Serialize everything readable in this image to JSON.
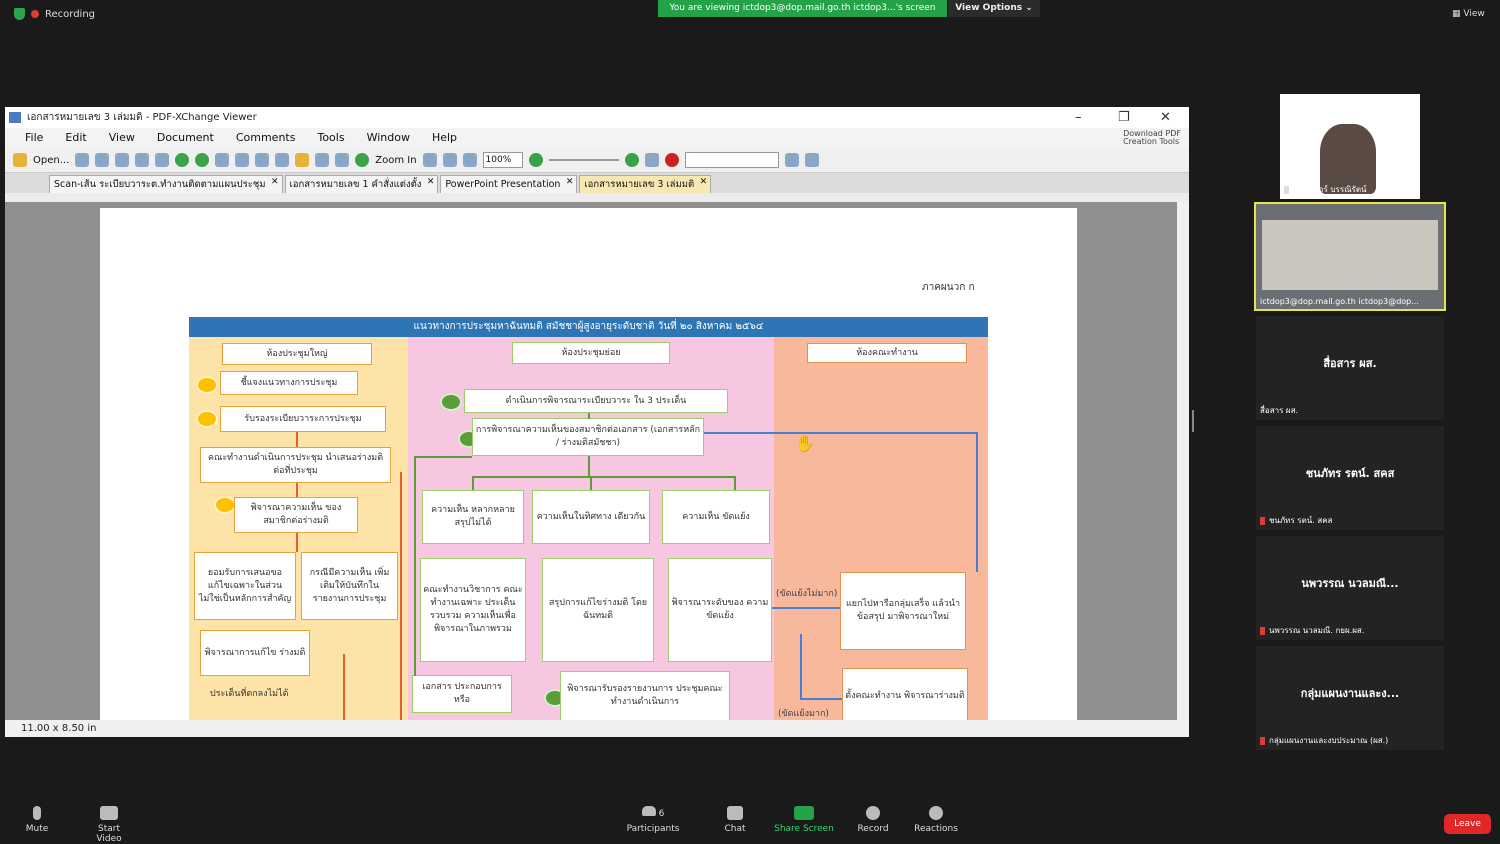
{
  "top": {
    "recording": "Recording",
    "banner": "You are viewing ictdop3@dop.mail.go.th ictdop3...'s screen",
    "view_options": "View Options",
    "view": "View"
  },
  "pdf": {
    "window_title": "เอกสารหมายเลข 3 เล่มมติ - PDF-XChange Viewer",
    "menu": [
      "File",
      "Edit",
      "View",
      "Document",
      "Comments",
      "Tools",
      "Window",
      "Help"
    ],
    "download_line1": "Download PDF",
    "download_line2": "Creation Tools",
    "open_label": "Open...",
    "zoom_in_label": "Zoom In",
    "zoom_value": "100%",
    "tabs": [
      "Scan-เส้น ระเบียบวาระต.ทำงานติดตามแผนประชุม",
      "เอกสารหมายเลข 1 คำสั่งแต่งตั้ง",
      "PowerPoint Presentation",
      "เอกสารหมายเลข 3 เล่มมติ"
    ],
    "page_size": "11.00 x 8.50 in"
  },
  "doc": {
    "annex": "ภาคผนวก ก",
    "flow_title": "แนวทางการประชุมหาฉันทมติ สมัชชาผู้สูงอายุระดับชาติ วันที่ ๒๐ สิงหาคม ๒๕๖๔",
    "col1_header": "ห้องประชุมใหญ่",
    "col2_header": "ห้องประชุมย่อย",
    "col3_header": "ห้องคณะทำงาน",
    "c1_1": "ชี้แจงแนวทางการประชุม",
    "c1_2": "รับรองระเบียบวาระการประชุม",
    "c1_3": "คณะทำงานดำเนินการประชุม นำเสนอร่างมติต่อที่ประชุม",
    "c1_4": "พิจารณาความเห็น ของสมาชิกต่อร่างมติ",
    "c1_5a": "ยอมรับการเสนอขอ แก้ไขเฉพาะในส่วน ไม่ใช่เป็นหลักการสำคัญ",
    "c1_5b": "กรณีมีความเห็น เพิ่มเติมให้บันทึกใน รายงานการประชุม",
    "c1_6": "พิจารณาการแก้ไข ร่างมติ",
    "c1_7": "ประเด็นที่ตกลงไม่ได้",
    "c2_1": "ดำเนินการพิจารณาระเบียบวาระ ใน 3 ประเด็น",
    "c2_2": "การพิจารณาความเห็นของสมาชิกต่อเอกสาร (เอกสารหลัก / ร่างมติสมัชชา)",
    "c2_3a": "ความเห็น หลากหลาย สรุปไม่ได้",
    "c2_3b": "ความเห็นในทิศทาง เดียวกัน",
    "c2_3c": "ความเห็น ขัดแย้ง",
    "c2_4a": "คณะทำงานวิชาการ คณะทำงานเฉพาะ ประเด็น รวบรวม ความเห็นเพื่อ พิจารณาในภาพรวม",
    "c2_4b": "สรุปการแก้ไขร่างมติ โดยฉันทมติ",
    "c2_4c": "พิจารณาระดับของ ความขัดแย้ง",
    "c2_5a": "เอกสาร ประกอบการหรือ",
    "c2_5b": "พิจารณารับรองรายงานการ ประชุมคณะทำงานดำเนินการ",
    "c3_1": "แยกไปหารือกลุ่มเสร็จ แล้วนำข้อสรุป มาพิจารณาใหม่",
    "c3_2": "ตั้งคณะทำงาน พิจารณาร่างมติ",
    "conflict_low": "(ขัดแย้งไม่มาก)",
    "conflict_high": "(ขัดแย้งมาก)"
  },
  "participants": {
    "tile1": "ภรรณิการ์ บรรณิรัตน์",
    "tile2": "ictdop3@dop.mail.go.th ictdop3@dop...",
    "tile3_big": "สื่อสาร ผส.",
    "tile3_small": "สื่อสาร ผส.",
    "tile4_big": "ชนภัทร รตน์. สคส",
    "tile4_small": "ชนภัทร รตน์. สคส",
    "tile5_big": "นพวรรณ นวลมณี...",
    "tile5_small": "นพวรรณ นวลมณี. กยผ.ผส.",
    "tile6_big": "กลุ่มแผนงานและง...",
    "tile6_small": "กลุ่มแผนงานและงบประมาณ (ผส.)"
  },
  "bottom": {
    "mute": "Mute",
    "start_video": "Start Video",
    "participants": "Participants",
    "participants_count": "6",
    "chat": "Chat",
    "share_screen": "Share Screen",
    "record": "Record",
    "reactions": "Reactions",
    "leave": "Leave"
  }
}
